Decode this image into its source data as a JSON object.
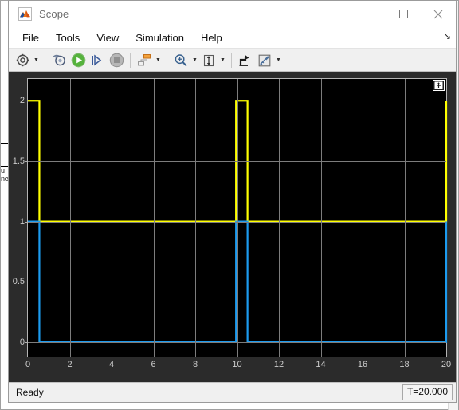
{
  "background_window": {
    "block_label": "u\nne",
    "scroll_arrow_icon": "chevron-down-icon"
  },
  "window": {
    "title": "Scope",
    "icon": "matlab-scope-icon",
    "controls": {
      "minimize": "minimize-icon",
      "maximize": "maximize-icon",
      "close": "close-icon"
    }
  },
  "menubar": {
    "items": [
      {
        "label": "File"
      },
      {
        "label": "Tools"
      },
      {
        "label": "View"
      },
      {
        "label": "Simulation"
      },
      {
        "label": "Help"
      }
    ],
    "expand_glyph": "↘"
  },
  "toolbar": {
    "buttons": [
      {
        "name": "configuration-properties-button",
        "icon": "gear-icon",
        "has_caret": true
      },
      {
        "name": "separator-1",
        "icon": "separator",
        "has_caret": false
      },
      {
        "name": "run-back-button",
        "icon": "rewind-icon",
        "has_caret": false
      },
      {
        "name": "run-button",
        "icon": "play-icon",
        "has_caret": false
      },
      {
        "name": "step-forward-button",
        "icon": "step-forward-icon",
        "has_caret": false
      },
      {
        "name": "stop-button",
        "icon": "stop-icon",
        "has_caret": false
      },
      {
        "name": "separator-2",
        "icon": "separator",
        "has_caret": false
      },
      {
        "name": "layout-button",
        "icon": "layout-icon",
        "has_caret": true
      },
      {
        "name": "separator-3",
        "icon": "separator",
        "has_caret": false
      },
      {
        "name": "zoom-button",
        "icon": "zoom-in-icon",
        "has_caret": true
      },
      {
        "name": "autoscale-button",
        "icon": "autoscale-icon",
        "has_caret": true
      },
      {
        "name": "separator-4",
        "icon": "separator",
        "has_caret": false
      },
      {
        "name": "cursor-measurements-button",
        "icon": "cursor-measure-icon",
        "has_caret": false
      },
      {
        "name": "signal-statistics-button",
        "icon": "ruler-icon",
        "has_caret": true
      }
    ]
  },
  "plot": {
    "corner_button_icon": "legend-toggle-icon",
    "background_color": "#000000",
    "grid_color": "#7d7d7d",
    "axes_color": "#b4b4b4"
  },
  "statusbar": {
    "status": "Ready",
    "time": "T=20.000"
  },
  "chart_data": {
    "type": "line",
    "title": "",
    "xlabel": "",
    "ylabel": "",
    "xlim": [
      0,
      20
    ],
    "ylim": [
      -0.12,
      2.18
    ],
    "xticks": [
      0,
      2,
      4,
      6,
      8,
      10,
      12,
      14,
      16,
      18,
      20
    ],
    "xtick_labels": [
      "0",
      "2",
      "4",
      "6",
      "8",
      "10",
      "12",
      "14",
      "16",
      "18",
      "20"
    ],
    "yticks": [
      0,
      0.5,
      1,
      1.5,
      2
    ],
    "ytick_labels": [
      "0",
      "0.5",
      "1",
      "1.5",
      "2"
    ],
    "grid": true,
    "legend": "none",
    "series": [
      {
        "name": "signal-yellow",
        "color": "#FFFF00",
        "points": [
          [
            0.0,
            2
          ],
          [
            0.55,
            2
          ],
          [
            0.55,
            1
          ],
          [
            9.95,
            1
          ],
          [
            9.95,
            2
          ],
          [
            10.5,
            2
          ],
          [
            10.5,
            1
          ],
          [
            20.0,
            1
          ],
          [
            20.0,
            2
          ]
        ]
      },
      {
        "name": "signal-blue",
        "color": "#1C9BEF",
        "points": [
          [
            0.0,
            1
          ],
          [
            0.55,
            1
          ],
          [
            0.55,
            0
          ],
          [
            9.95,
            0
          ],
          [
            9.95,
            1
          ],
          [
            10.5,
            1
          ],
          [
            10.5,
            0
          ],
          [
            20.0,
            0
          ],
          [
            20.0,
            1
          ]
        ]
      }
    ]
  }
}
